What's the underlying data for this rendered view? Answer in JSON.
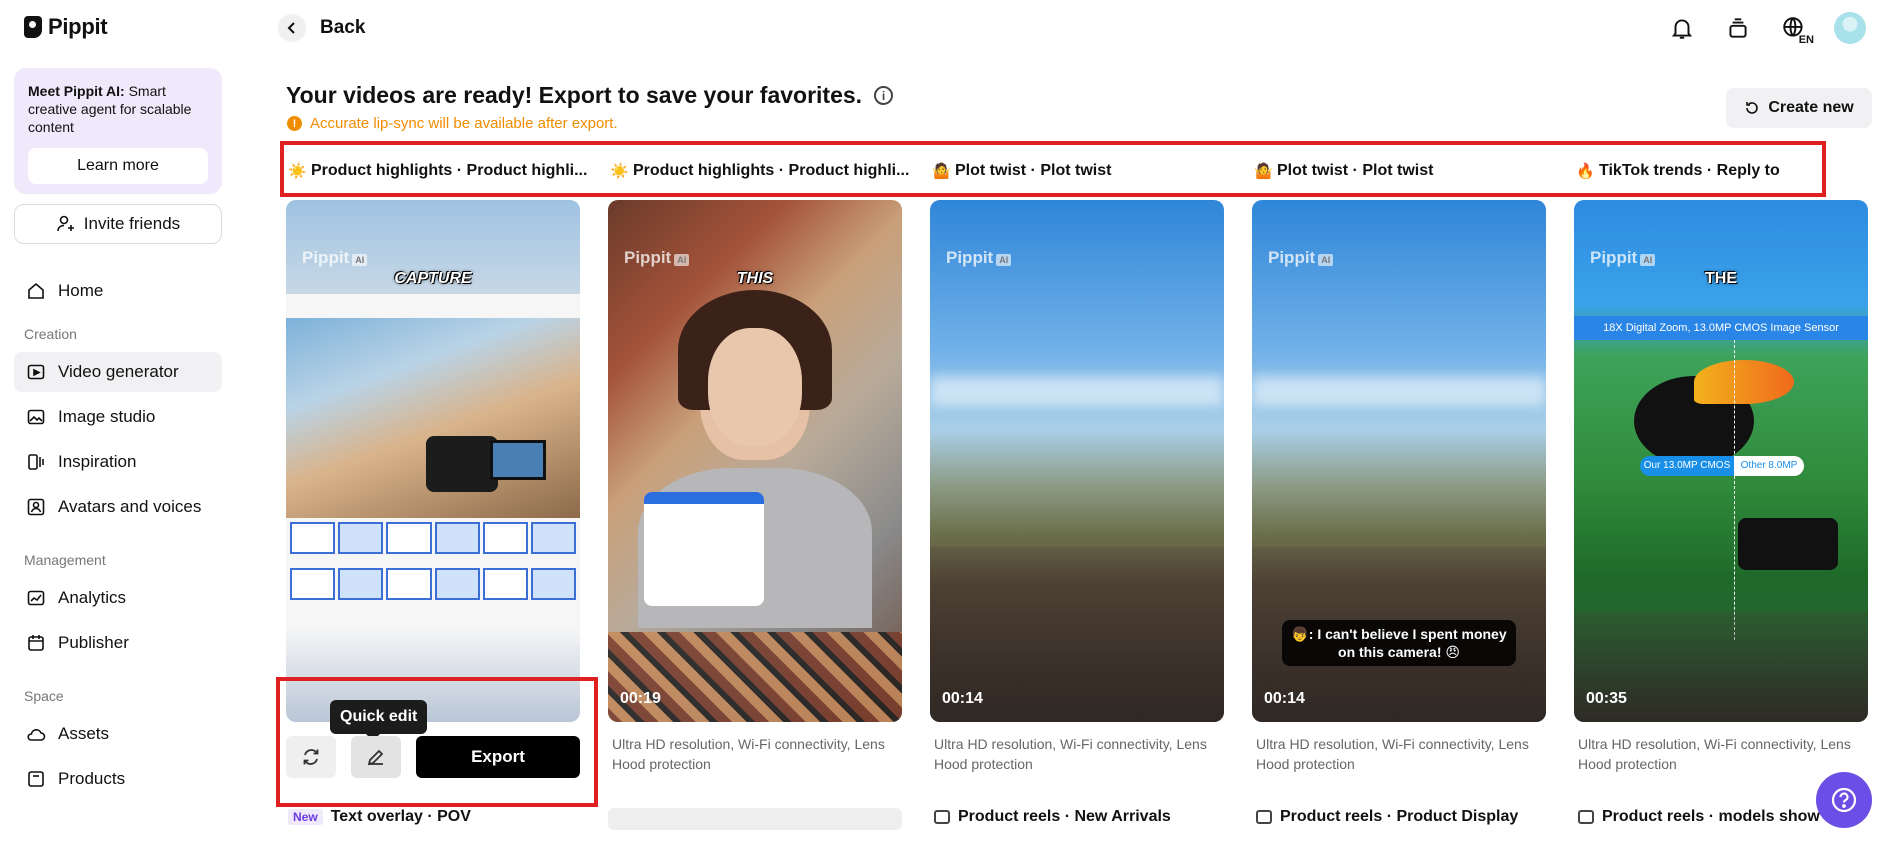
{
  "app": {
    "logo_text": "Pippit"
  },
  "sidebar": {
    "promo": {
      "title": "Meet Pippit AI:",
      "body": " Smart creative agent for scalable content",
      "button": "Learn more"
    },
    "invite": "Invite friends",
    "home": "Home",
    "sections": {
      "creation": "Creation",
      "management": "Management",
      "space": "Space"
    },
    "creation_items": [
      {
        "label": "Video generator",
        "icon": "video-generator-icon",
        "active": true
      },
      {
        "label": "Image studio",
        "icon": "image-studio-icon",
        "active": false
      },
      {
        "label": "Inspiration",
        "icon": "inspiration-icon",
        "active": false
      },
      {
        "label": "Avatars and voices",
        "icon": "avatars-icon",
        "active": false
      }
    ],
    "management_items": [
      {
        "label": "Analytics",
        "icon": "analytics-icon"
      },
      {
        "label": "Publisher",
        "icon": "calendar-icon"
      }
    ],
    "space_items": [
      {
        "label": "Assets",
        "icon": "cloud-icon"
      },
      {
        "label": "Products",
        "icon": "products-icon"
      }
    ]
  },
  "topbar": {
    "back": "Back",
    "language": "EN",
    "icons": [
      "bell-icon",
      "layers-icon",
      "globe-icon",
      "avatar"
    ]
  },
  "header": {
    "title": "Your videos are ready! Export to save your favorites.",
    "warning": "Accurate lip-sync will be available after export.",
    "create_new": "Create new"
  },
  "categories": [
    {
      "emoji": "☀️",
      "label": "Product highlights · Product highli..."
    },
    {
      "emoji": "☀️",
      "label": "Product highlights · Product highli..."
    },
    {
      "emoji": "🤷",
      "label": "Plot twist · Plot twist"
    },
    {
      "emoji": "🤷",
      "label": "Plot twist · Plot twist"
    },
    {
      "emoji": "🔥",
      "label": "TikTok trends · Reply to"
    }
  ],
  "cards": [
    {
      "caption_word": "CAPTURE",
      "duration": "",
      "description": ""
    },
    {
      "caption_word": "THIS",
      "duration": "00:19",
      "description": "Ultra HD resolution, Wi-Fi connectivity, Lens Hood protection"
    },
    {
      "caption_word": "",
      "duration": "00:14",
      "description": "Ultra HD resolution, Wi-Fi connectivity, Lens Hood protection"
    },
    {
      "caption_word": "",
      "duration": "00:14",
      "description": "Ultra HD resolution, Wi-Fi connectivity, Lens Hood protection",
      "subtitle": "👦: I can't believe I spent money on this camera! 😠"
    },
    {
      "caption_word": "THE",
      "duration": "00:35",
      "description": "Ultra HD resolution, Wi-Fi connectivity, Lens Hood protection",
      "banner": "18X Digital Zoom, 13.0MP CMOS Image Sensor",
      "compare_a": "Our 13.0MP CMOS",
      "compare_b": "Other 8.0MP"
    }
  ],
  "watermark": {
    "brand": "Pippit",
    "tag": "AI"
  },
  "quick_edit": {
    "tooltip": "Quick edit",
    "export": "Export"
  },
  "next_row": [
    {
      "badge": "New",
      "label": "Text overlay · POV"
    },
    {
      "label": "Product reels · New Arrivals"
    },
    {
      "label": "Product reels · Product Display"
    },
    {
      "label": "Product reels · models show"
    }
  ],
  "colors": {
    "accent": "#6b4ee6",
    "warning": "#f08c00",
    "highlight_frame": "#e02020",
    "promo_bg": "#efe9fb"
  }
}
